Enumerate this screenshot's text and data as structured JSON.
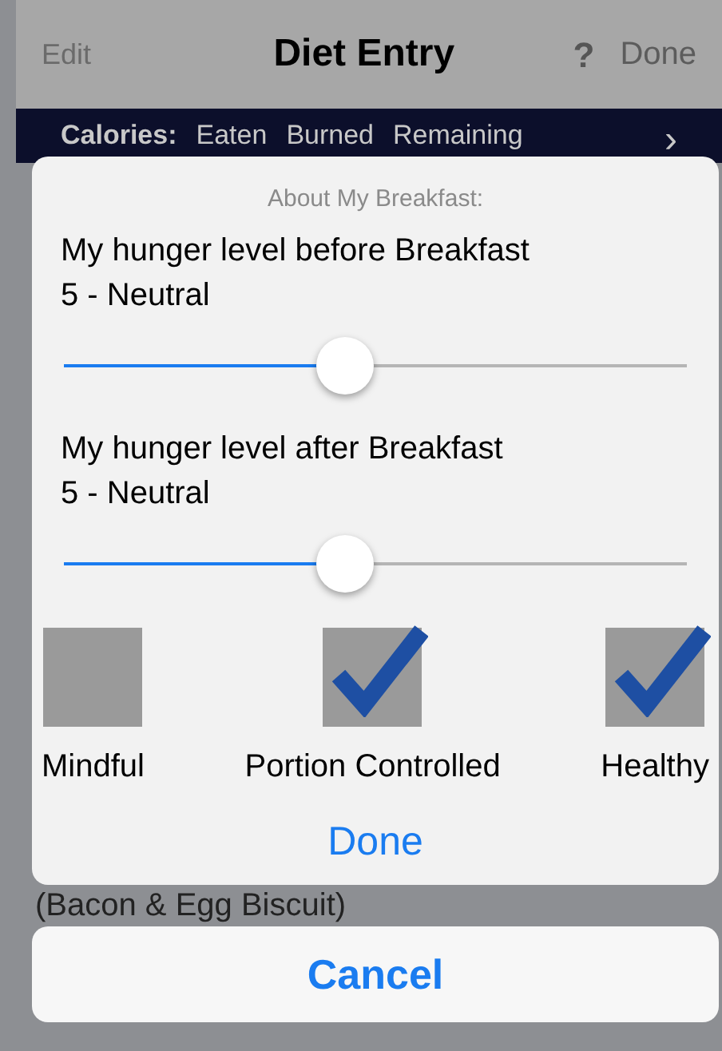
{
  "nav": {
    "left": "Edit",
    "title": "Diet Entry",
    "help": "?",
    "right": "Done"
  },
  "calories_bar": {
    "label": "Calories:",
    "columns": [
      "Eaten",
      "Burned",
      "Remaining"
    ],
    "arrow": "›"
  },
  "sheet": {
    "heading": "About My Breakfast:",
    "sliders": [
      {
        "label": "My hunger level before Breakfast",
        "reading": "5 - Neutral",
        "level": 0.45
      },
      {
        "label": "My hunger level after Breakfast",
        "reading": "5 - Neutral",
        "level": 0.45
      }
    ],
    "options": [
      {
        "label": "Mindful",
        "checked": false
      },
      {
        "label": "Portion Controlled",
        "checked": true
      },
      {
        "label": "Healthy",
        "checked": true
      }
    ],
    "done": "Done"
  },
  "background_row": "(Bacon & Egg Biscuit)",
  "cancel": "Cancel"
}
